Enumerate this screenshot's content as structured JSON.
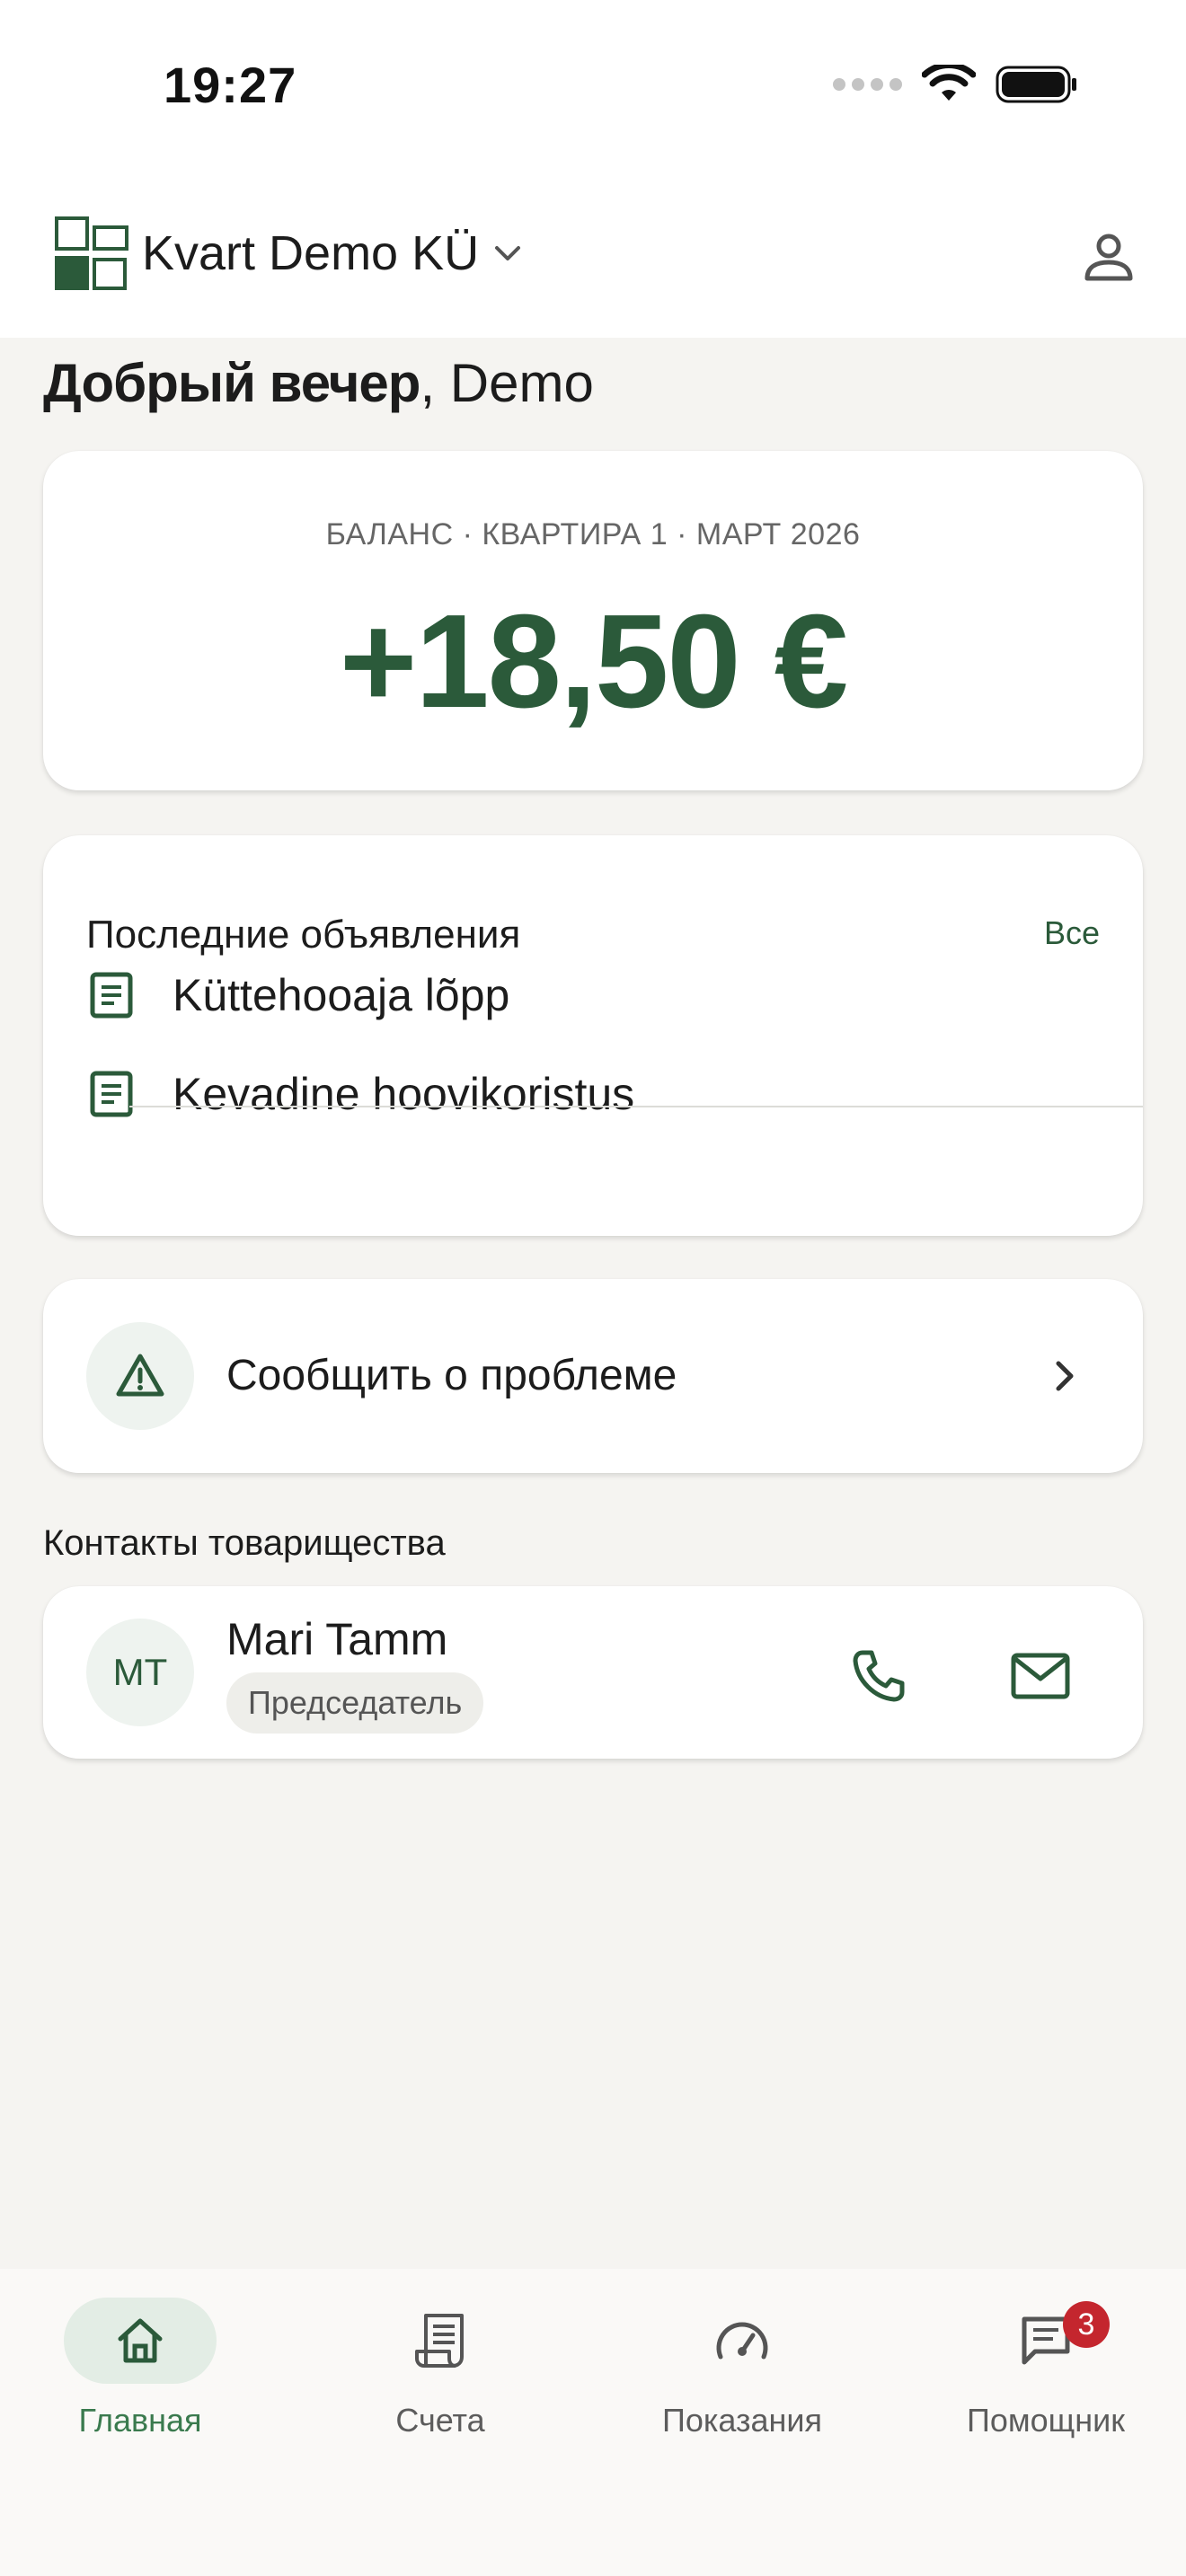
{
  "status_bar": {
    "time": "19:27"
  },
  "header": {
    "org_name": "Kvart Demo KÜ"
  },
  "greeting": {
    "prefix": "Добрый вечер",
    "name": ", Demo"
  },
  "balance": {
    "label": "БАЛАНС · КВАРТИРА 1 · МАРТ 2026",
    "amount": "+18,50 €"
  },
  "announcements": {
    "title": "Последние объявления",
    "all_link": "Все",
    "items": [
      {
        "title": "Küttehooaja lõpp"
      },
      {
        "title": "Kevadine hoovikoristus"
      }
    ]
  },
  "report_problem": {
    "label": "Сообщить о проблеме"
  },
  "contacts": {
    "heading": "Контакты товарищества",
    "items": [
      {
        "initials": "MT",
        "name": "Mari Tamm",
        "role": "Председатель"
      }
    ]
  },
  "bottom_nav": {
    "items": [
      {
        "label": "Главная",
        "icon": "home-icon",
        "active": true
      },
      {
        "label": "Счета",
        "icon": "receipt-icon"
      },
      {
        "label": "Показания",
        "icon": "gauge-icon"
      },
      {
        "label": "Помощник",
        "icon": "chat-icon",
        "badge": "3"
      }
    ]
  },
  "colors": {
    "accent": "#2b5a3a",
    "accent_light": "#e3ede5",
    "background": "#f5f4f1",
    "badge": "#c4262e"
  }
}
